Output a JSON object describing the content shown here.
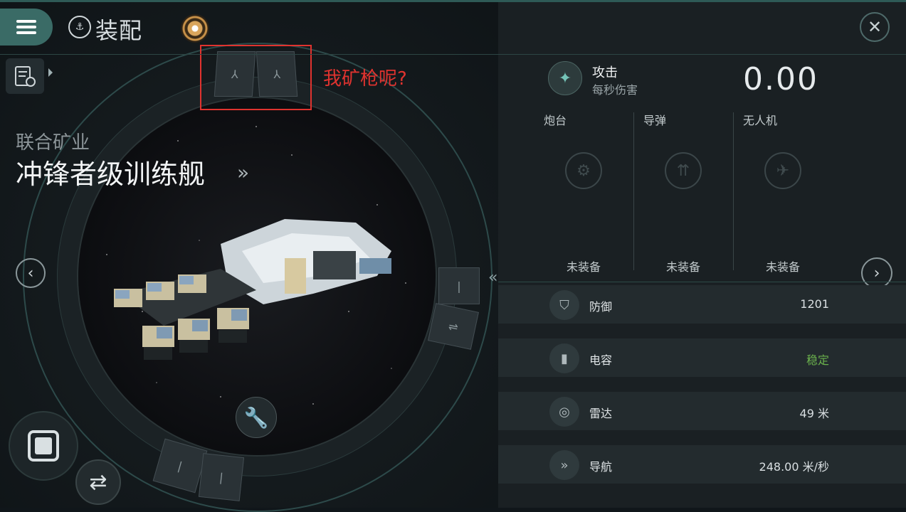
{
  "header": {
    "title": "装配",
    "menu_icon": "menu-icon",
    "title_icon": "ship-fitting-icon",
    "close_icon": "close-icon"
  },
  "ship": {
    "corporation": "联合矿业",
    "name": "冲锋者级训练舰",
    "name_arrow": "»"
  },
  "annotation": {
    "text": "我矿枪呢?",
    "color": "#e0332f"
  },
  "attack": {
    "label": "攻击",
    "sublabel": "每秒伤害",
    "value": "0.00"
  },
  "weapons": [
    {
      "label": "炮台",
      "status": "未装备",
      "icon": "turret-icon"
    },
    {
      "label": "导弹",
      "status": "未装备",
      "icon": "missile-icon"
    },
    {
      "label": "无人机",
      "status": "未装备",
      "icon": "drone-icon"
    }
  ],
  "stats": [
    {
      "label": "防御",
      "value": "1201",
      "icon": "shield-icon"
    },
    {
      "label": "电容",
      "value": "稳定",
      "icon": "capacitor-icon",
      "value_color": "#6ab04c"
    },
    {
      "label": "雷达",
      "value": "49 米",
      "icon": "radar-icon"
    },
    {
      "label": "导航",
      "value": "248.00 米/秒",
      "icon": "navigation-icon"
    }
  ],
  "colors": {
    "accent_teal": "#3a6b66",
    "stable_green": "#6ab04c",
    "annotation_red": "#e0332f"
  }
}
